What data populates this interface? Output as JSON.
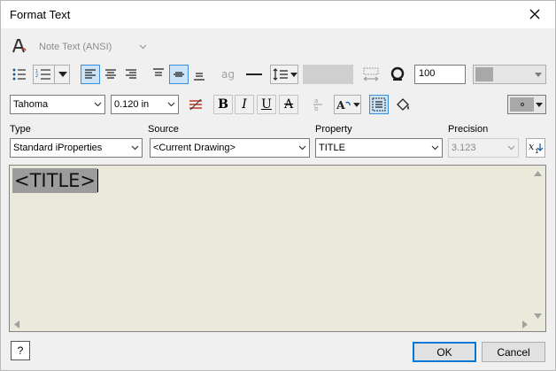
{
  "window": {
    "title": "Format Text"
  },
  "toolbar1": {
    "style_value": "Note Text (ANSI)"
  },
  "toolbar2": {
    "stretch_value": "100"
  },
  "toolbar3": {
    "font_value": "Tahoma",
    "size_value": "0.120 in",
    "bold_label": "B",
    "italic_label": "I",
    "underline_label": "U",
    "strike_label": "A"
  },
  "fields": {
    "type_label": "Type",
    "type_value": "Standard iProperties",
    "source_label": "Source",
    "source_value": "<Current Drawing>",
    "property_label": "Property",
    "property_value": "TITLE",
    "precision_label": "Precision",
    "precision_value": "3.123"
  },
  "editor": {
    "content": "<TITLE>"
  },
  "footer": {
    "ok_label": "OK",
    "cancel_label": "Cancel",
    "help_label": "?"
  },
  "colors": {
    "accent": "#0078d7",
    "editor_background": "#ebe8dc",
    "selection": "#9c9c9c",
    "pressed_button": "#cce4f7"
  }
}
